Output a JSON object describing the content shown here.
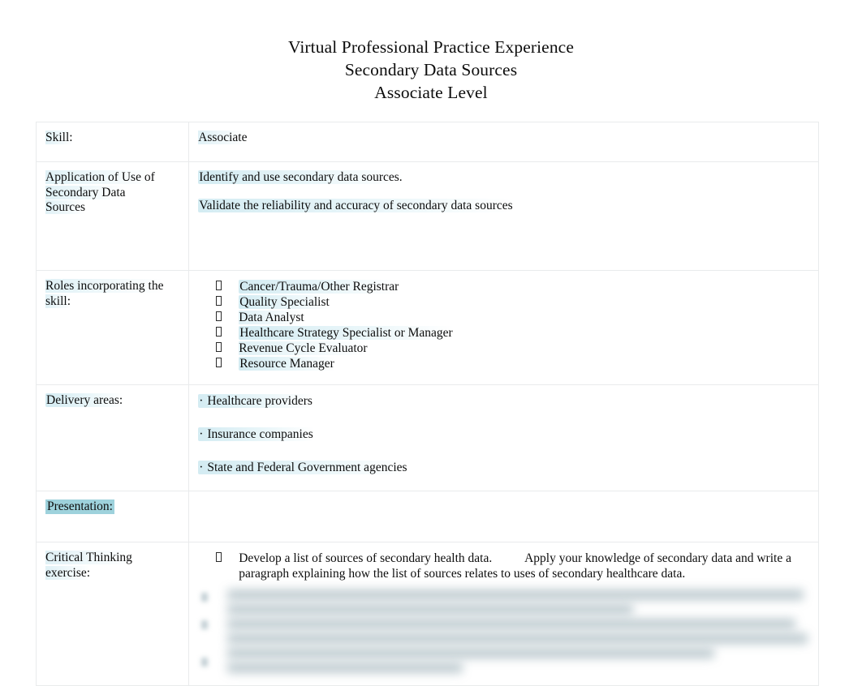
{
  "document": {
    "title_lines": [
      "Virtual Professional Practice Experience",
      "Secondary Data Sources",
      "Associate Level"
    ]
  },
  "colors": {
    "highlight_teal": "#9ed2dc",
    "highlight_wash": "#b0dce8",
    "table_border": "#e9ebec",
    "text": "#0d0d0d",
    "blur_gray": "#b3c2c8"
  },
  "table": {
    "rows": [
      {
        "label": "Skill:",
        "value": "Associate"
      },
      {
        "label_lines": [
          "Application of Use of",
          "Secondary Data",
          "Sources"
        ],
        "paragraphs": [
          "Identify and use secondary data sources.",
          "Validate the reliability and accuracy of secondary data sources"
        ]
      },
      {
        "label_lines": [
          "Roles incorporating the",
          "skill:"
        ],
        "bullets": [
          "Cancer/Trauma/Other Registrar",
          "Quality Specialist",
          "Data Analyst",
          "Healthcare Strategy Specialist or Manager",
          "Revenue Cycle Evaluator",
          "Resource Manager"
        ]
      },
      {
        "label": "Delivery areas:",
        "bullet_char": "·",
        "bullets": [
          "Healthcare providers",
          "Insurance companies",
          "State and Federal Government agencies"
        ]
      },
      {
        "label": "Presentation:",
        "value": ""
      },
      {
        "label_lines": [
          "Critical Thinking",
          "exercise:"
        ],
        "exercise_lines": [
          "Develop a list of sources of secondary health data.",
          "Apply your knowledge of secondary data and",
          "write a paragraph explaining how the list of sources relates to uses of secondary healthcare data."
        ],
        "obscured_note": "(remaining content is blurred and illegible)"
      }
    ]
  }
}
